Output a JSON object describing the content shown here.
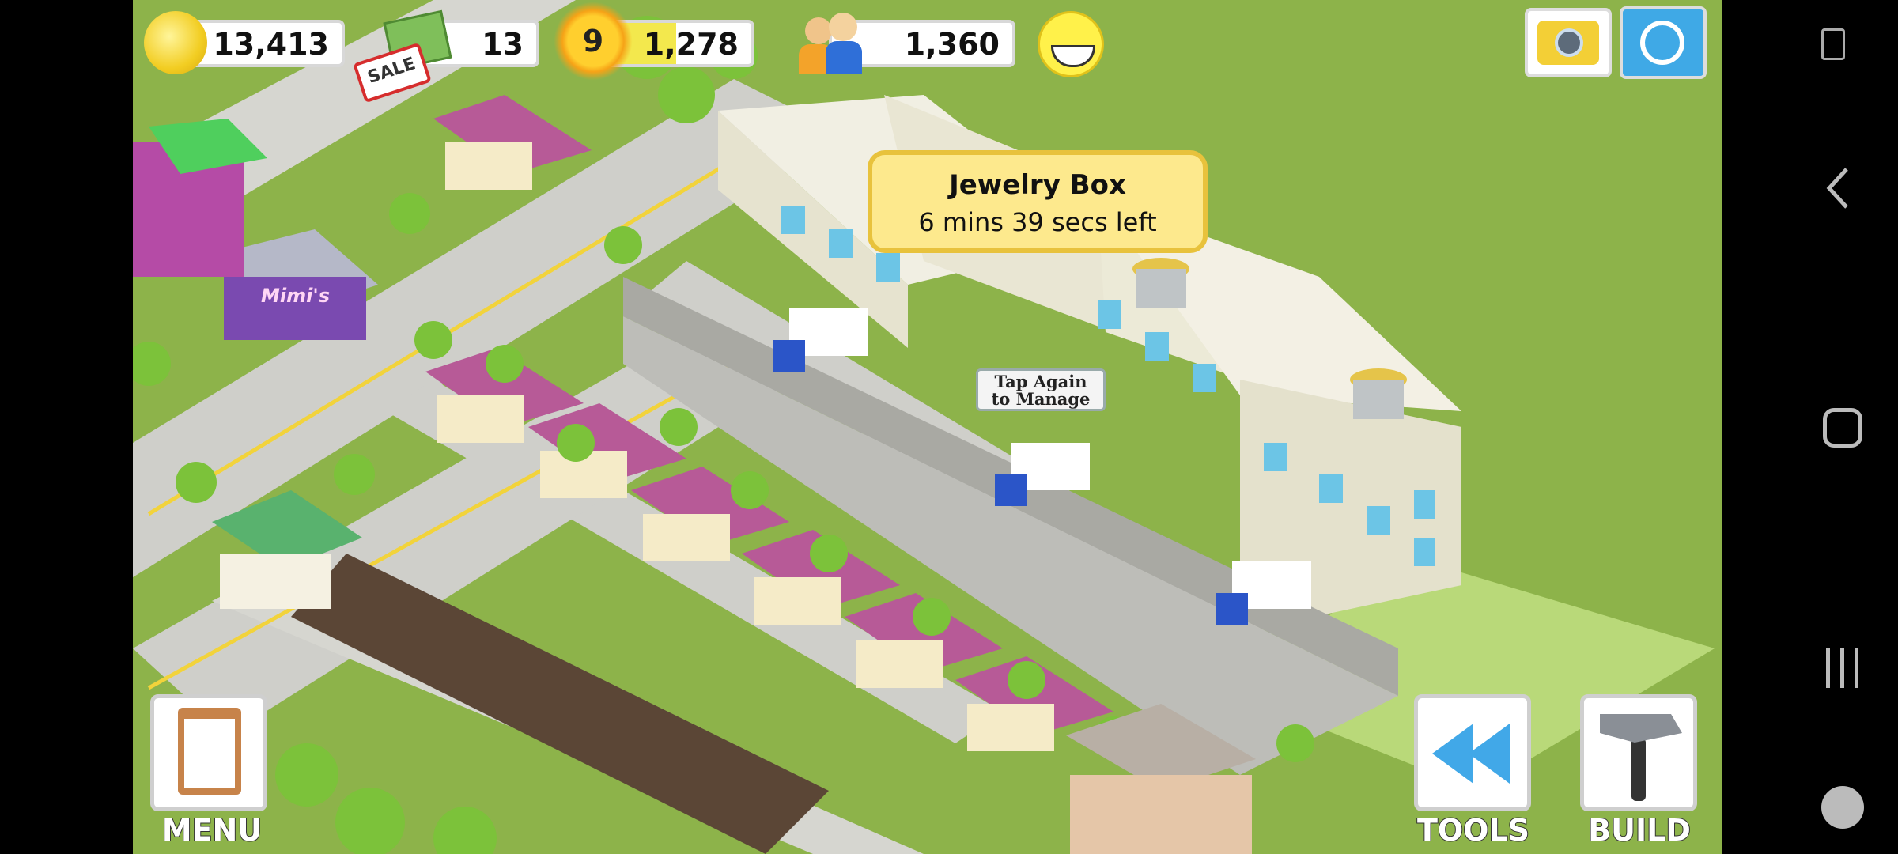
{
  "hud": {
    "coins": "13,413",
    "cash": "13",
    "level": "9",
    "xp": "1,278",
    "population": "1,360"
  },
  "sale_badge": "SALE",
  "tooltip": {
    "title": "Jewelry Box",
    "subtitle": "6 mins 39 secs left"
  },
  "sign_text_line1": "Tap Again",
  "sign_text_line2": "to Manage",
  "shop_sign": "Mimi's",
  "buttons": {
    "menu": "MENU",
    "tools": "TOOLS",
    "build": "BUILD"
  },
  "colors": {
    "grass": "#8db34a",
    "road": "#c9c9c4",
    "roof_purple": "#b75a97",
    "tooltip_bg": "#fde98d"
  },
  "icons": [
    "coin-icon",
    "cash-icon",
    "sun-level-icon",
    "population-icon",
    "smiley-icon",
    "camera-icon",
    "share-icon",
    "clipboard-icon",
    "rewind-icon",
    "hammer-icon"
  ]
}
